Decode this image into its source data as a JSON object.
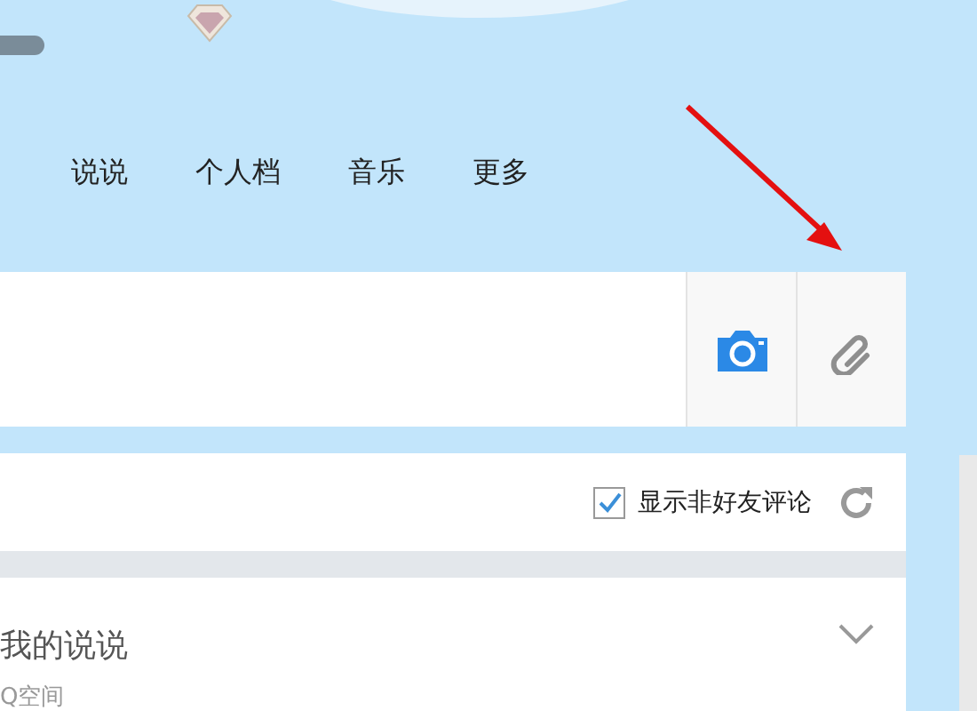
{
  "nav": {
    "items": [
      {
        "label": "说说"
      },
      {
        "label": "个人档"
      },
      {
        "label": "音乐"
      },
      {
        "label": "更多"
      }
    ]
  },
  "filter": {
    "checkbox": {
      "label": "显示非好友评论",
      "checked": true
    }
  },
  "card": {
    "title": "我的说说",
    "subtitle": "Q空间"
  }
}
